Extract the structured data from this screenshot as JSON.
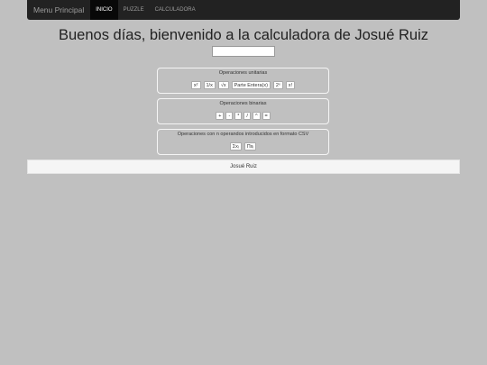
{
  "nav": {
    "brand": "Menu Principal",
    "items": [
      {
        "label": "INICIO",
        "active": true
      },
      {
        "label": "PUZZLE",
        "active": false
      },
      {
        "label": "CALCULADORA",
        "active": false
      }
    ]
  },
  "page_title": "Buenos días, bienvenido a la calculadora de Josué Ruiz",
  "display": {
    "value": ""
  },
  "unary": {
    "title": "Operaciones unitarias",
    "buttons": [
      "x²",
      "1/x",
      "√x",
      "Parte Entera(x)",
      "2ˣ",
      "x!"
    ]
  },
  "binary": {
    "title": "Operaciones binarias",
    "buttons": [
      "+",
      "-",
      "*",
      "/",
      "^",
      "="
    ]
  },
  "nary": {
    "title": "Operaciones con n operandos introducidos en formato CSV",
    "buttons": [
      "Σxᵢ",
      "Πxᵢ"
    ]
  },
  "footer": {
    "text": "Josué Ruiz"
  },
  "colors": {
    "background": "#c0c0c0",
    "navbar": "#222222",
    "nav_active": "#080808"
  }
}
